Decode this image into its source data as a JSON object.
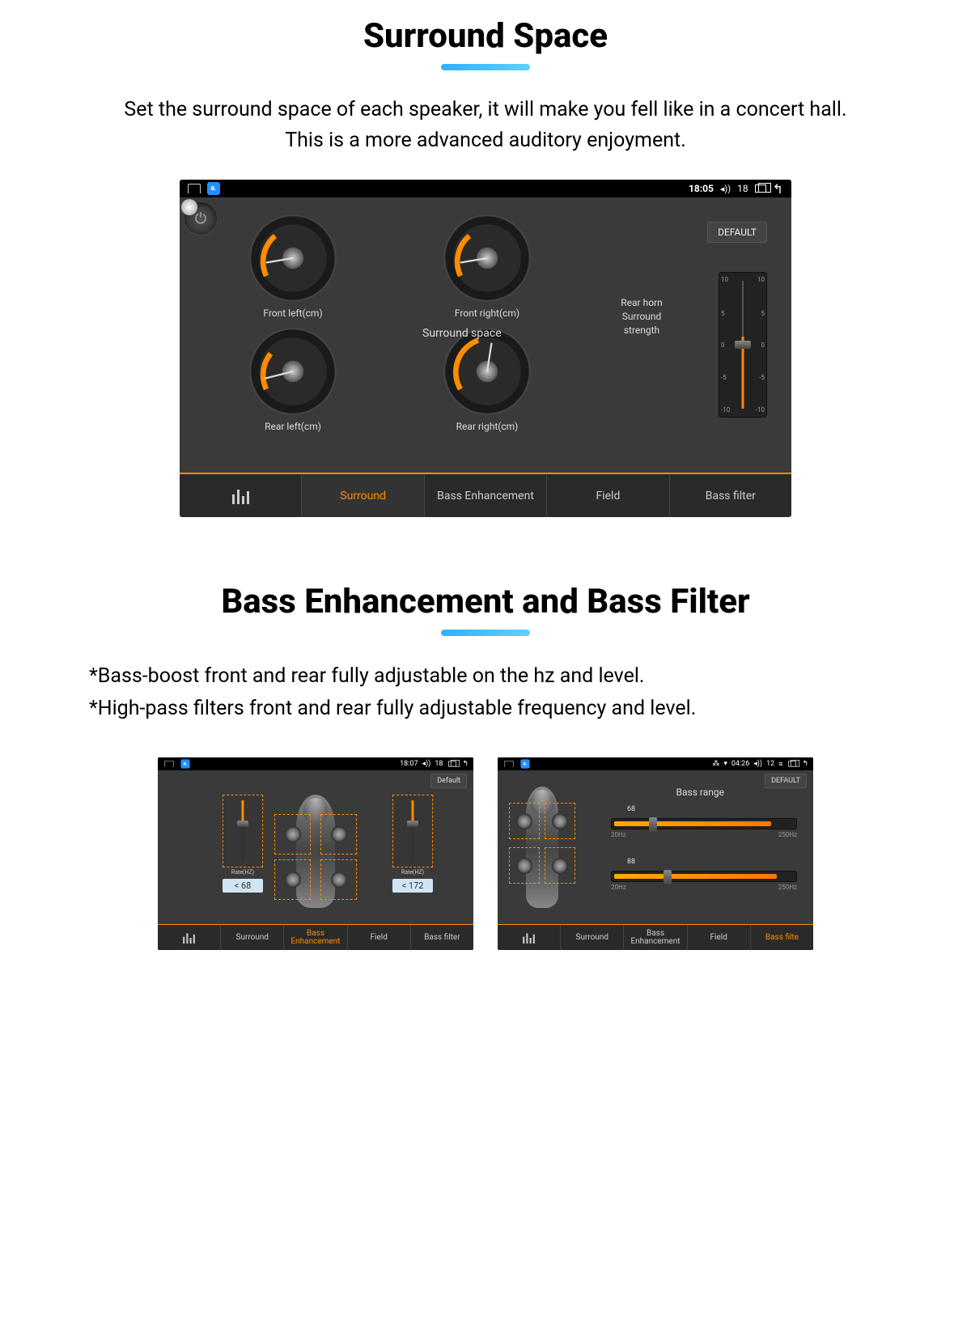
{
  "section1": {
    "title": "Surround Space",
    "desc": "Set the surround space of each speaker, it will make you fell like in a concert hall.\nThis is a more advanced auditory enjoyment."
  },
  "main": {
    "status": {
      "time": "18:05",
      "volume": "18"
    },
    "power_icon": "⏻",
    "surround_label": "Surround space",
    "gauges": {
      "ticks": [
        "-27.2",
        "-54.4",
        "81.6",
        "109",
        "136",
        "163",
        "190",
        "218",
        "245",
        "272"
      ],
      "fl": "Front left(cm)",
      "fr": "Front right(cm)",
      "rl": "Rear left(cm)",
      "rr": "Rear right(cm)"
    },
    "horn": {
      "default_btn": "DEFAULT",
      "label": "Rear horn Surround strength",
      "scale_top": "10",
      "scale_mid1": "5",
      "scale_zero": "0",
      "scale_mid2": "-5",
      "scale_bot": "-10"
    },
    "tabs": {
      "surround": "Surround",
      "bass_enh": "Bass Enhancement",
      "field": "Field",
      "bass_filter": "Bass filter"
    }
  },
  "section2": {
    "title": "Bass Enhancement and Bass Filter",
    "line1": "*Bass-boost front and rear fully adjustable on the hz and level.",
    "line2": "*High-pass filters front and rear fully adjustable frequency and level."
  },
  "small1": {
    "status": {
      "time": "18:07",
      "volume": "18"
    },
    "default_btn": "Default",
    "rate_label": "Rate(HZ)",
    "val_left": "< 68",
    "val_right": "< 172",
    "tabs": {
      "surround": "Surround",
      "bass_enh": "Bass Enhancement",
      "field": "Field",
      "bass_filter": "Bass filter"
    }
  },
  "small2": {
    "status": {
      "time": "04:26",
      "volume": "12"
    },
    "default_btn": "DEFAULT",
    "bass_range": "Bass range",
    "slider1": {
      "val": "68",
      "min": "20Hz",
      "max": "250Hz",
      "pct": 85
    },
    "slider2": {
      "val": "88",
      "min": "20Hz",
      "max": "250Hz",
      "pct": 88
    },
    "tabs": {
      "surround": "Surround",
      "bass_enh": "Bass\nEnhancement",
      "field": "Field",
      "bass_filter": "Bass filte"
    }
  }
}
